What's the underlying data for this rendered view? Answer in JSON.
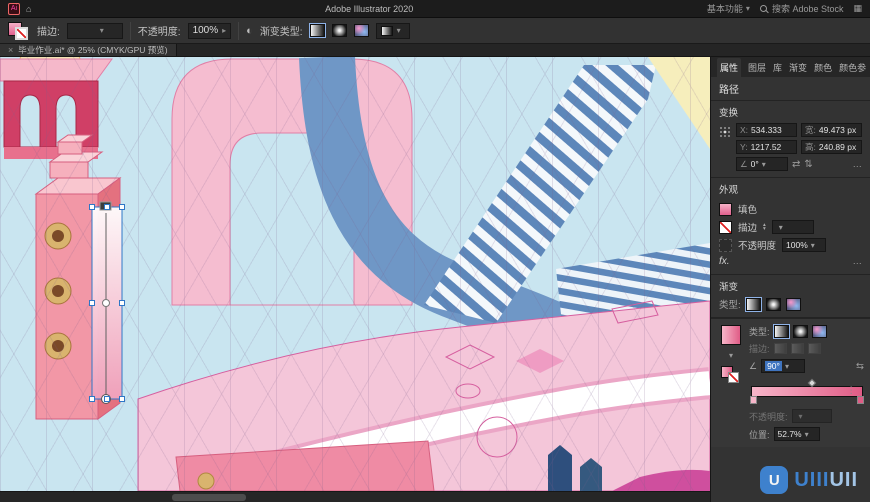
{
  "icons": {
    "chevron_down": "▾",
    "chevron_up": "▴",
    "chevron_right": "▸",
    "close": "×",
    "menu": "≡",
    "more": "…",
    "home": "⌂",
    "grid": "▦",
    "app": "Ai",
    "flip_h": "⇄",
    "flip_v": "⇅",
    "angle": "∠",
    "reverse": "⇆",
    "profile": "◐",
    "dots": "⋮",
    "fx": "fx."
  },
  "titlebar": {
    "title": "Adobe Illustrator 2020",
    "workspace": "基本功能",
    "search": "搜索 Adobe Stock"
  },
  "controlbar": {
    "stroke_label": "描边:",
    "opacity_label": "不透明度:",
    "opacity_value": "100%",
    "gradient_type_label": "渐变类型:"
  },
  "doctab": {
    "label": "毕业作业.ai* @ 25% (CMYK/GPU 预览)"
  },
  "panel": {
    "tabs": [
      "属性",
      "图层",
      "库",
      "渐变",
      "颜色",
      "颜色参"
    ],
    "object_type": "路径",
    "transform": {
      "header": "变换",
      "x_label": "X:",
      "x_value": "534.333",
      "y_label": "Y:",
      "y_value": "1217.52",
      "w_label": "宽:",
      "w_value": "49.473 px",
      "h_label": "高:",
      "h_value": "240.89 px",
      "angle_value": "0°"
    },
    "appearance": {
      "header": "外观",
      "fill_label": "填色",
      "stroke_label": "描边",
      "opacity_label": "不透明度",
      "opacity_value": "100%"
    },
    "gradient_section": {
      "header": "渐变",
      "type_label": "类型:"
    },
    "gradient_panel": {
      "type_label": "类型:",
      "stroke_label": "描边:",
      "angle_value": "90°",
      "opacity_label": "不透明度:",
      "location_label": "位置:",
      "location_value": "52.7%"
    }
  },
  "watermark": {
    "text_primary": "UIII",
    "text_secondary": "UII",
    "logo_letter": "U"
  },
  "colors": {
    "accent_blue": "#3f74bf",
    "canvas_bg": "#c9e5f0",
    "art_pink": "#f2a0b8",
    "art_blue": "#6f97c6",
    "art_magenta": "#cf4f9e",
    "gradient_start": "#f7b6c9",
    "gradient_end": "#e05c86"
  }
}
